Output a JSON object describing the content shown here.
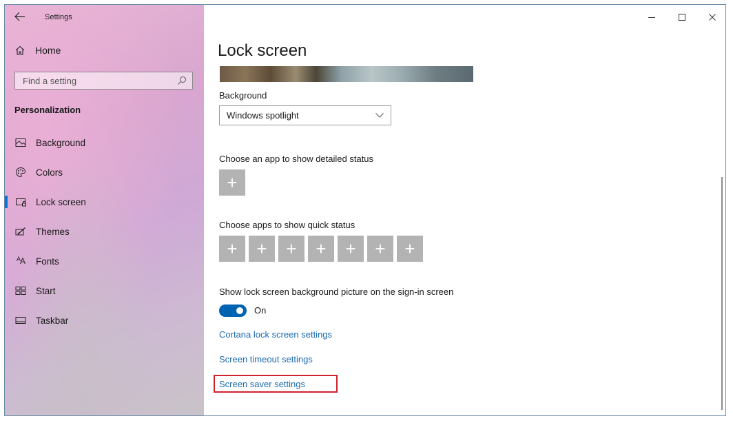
{
  "window": {
    "title": "Settings",
    "controls": {
      "minimize": "—",
      "maximize": "☐",
      "close": "✕"
    }
  },
  "sidebar": {
    "home_label": "Home",
    "search": {
      "placeholder": "Find a setting",
      "value": ""
    },
    "section_label": "Personalization",
    "items": [
      {
        "label": "Background",
        "icon": "picture-icon",
        "active": false
      },
      {
        "label": "Colors",
        "icon": "palette-icon",
        "active": false
      },
      {
        "label": "Lock screen",
        "icon": "lock-screen-icon",
        "active": true
      },
      {
        "label": "Themes",
        "icon": "brush-icon",
        "active": false
      },
      {
        "label": "Fonts",
        "icon": "font-icon",
        "active": false
      },
      {
        "label": "Start",
        "icon": "start-icon",
        "active": false
      },
      {
        "label": "Taskbar",
        "icon": "taskbar-icon",
        "active": false
      }
    ],
    "accent_color": "#0078d7"
  },
  "main": {
    "page_title": "Lock screen",
    "background": {
      "label": "Background",
      "dropdown_value": "Windows spotlight"
    },
    "detailed_status": {
      "label": "Choose an app to show detailed status",
      "button_symbol": "+"
    },
    "quick_status": {
      "label": "Choose apps to show quick status",
      "buttons": [
        "+",
        "+",
        "+",
        "+",
        "+",
        "+",
        "+"
      ]
    },
    "signin_picture": {
      "label": "Show lock screen background picture on the sign-in screen",
      "toggle_state": "On",
      "toggle_on": true
    },
    "links": {
      "cortana": "Cortana lock screen settings",
      "timeout": "Screen timeout settings",
      "screensaver": "Screen saver settings"
    },
    "link_color": "#1b6ab0",
    "highlight_color": "#d0212a"
  }
}
